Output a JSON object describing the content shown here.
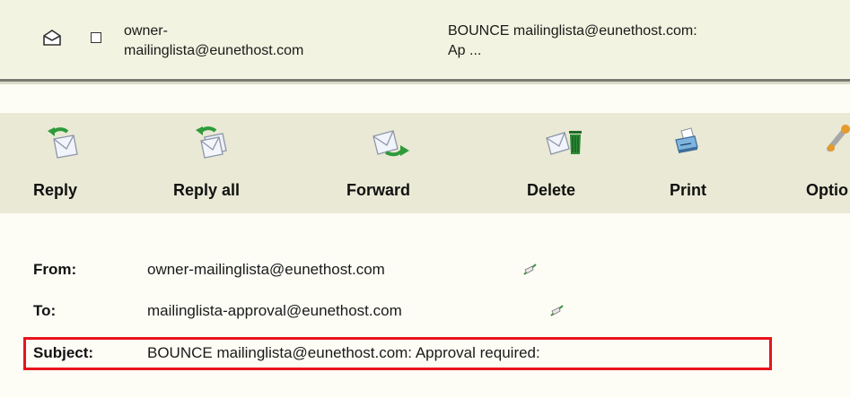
{
  "message_list": {
    "row": {
      "sender": "owner-mailinglista@eunethost.com",
      "sender_line1": "owner-",
      "sender_line2": "mailinglista@eunethost.com",
      "subject_line1": "BOUNCE mailinglista@eunethost.com:",
      "subject_line2": "Ap ..."
    }
  },
  "toolbar": {
    "buttons": [
      {
        "label": "Reply",
        "icon": "reply-icon"
      },
      {
        "label": "Reply all",
        "icon": "reply-all-icon"
      },
      {
        "label": "Forward",
        "icon": "forward-icon"
      },
      {
        "label": "Delete",
        "icon": "delete-icon"
      },
      {
        "label": "Print",
        "icon": "print-icon"
      },
      {
        "label": "Optio",
        "icon": "options-icon"
      }
    ]
  },
  "headers": {
    "from_label": "From:",
    "from_value": "owner-mailinglista@eunethost.com",
    "to_label": "To:",
    "to_value": "mailinglista-approval@eunethost.com",
    "subject_label": "Subject:",
    "subject_value": "BOUNCE mailinglista@eunethost.com: Approval required:"
  },
  "colors": {
    "highlight_border": "#e8141c",
    "toolbar_bg": "#e9e9d5",
    "list_row_bg": "#f3f3e1"
  }
}
